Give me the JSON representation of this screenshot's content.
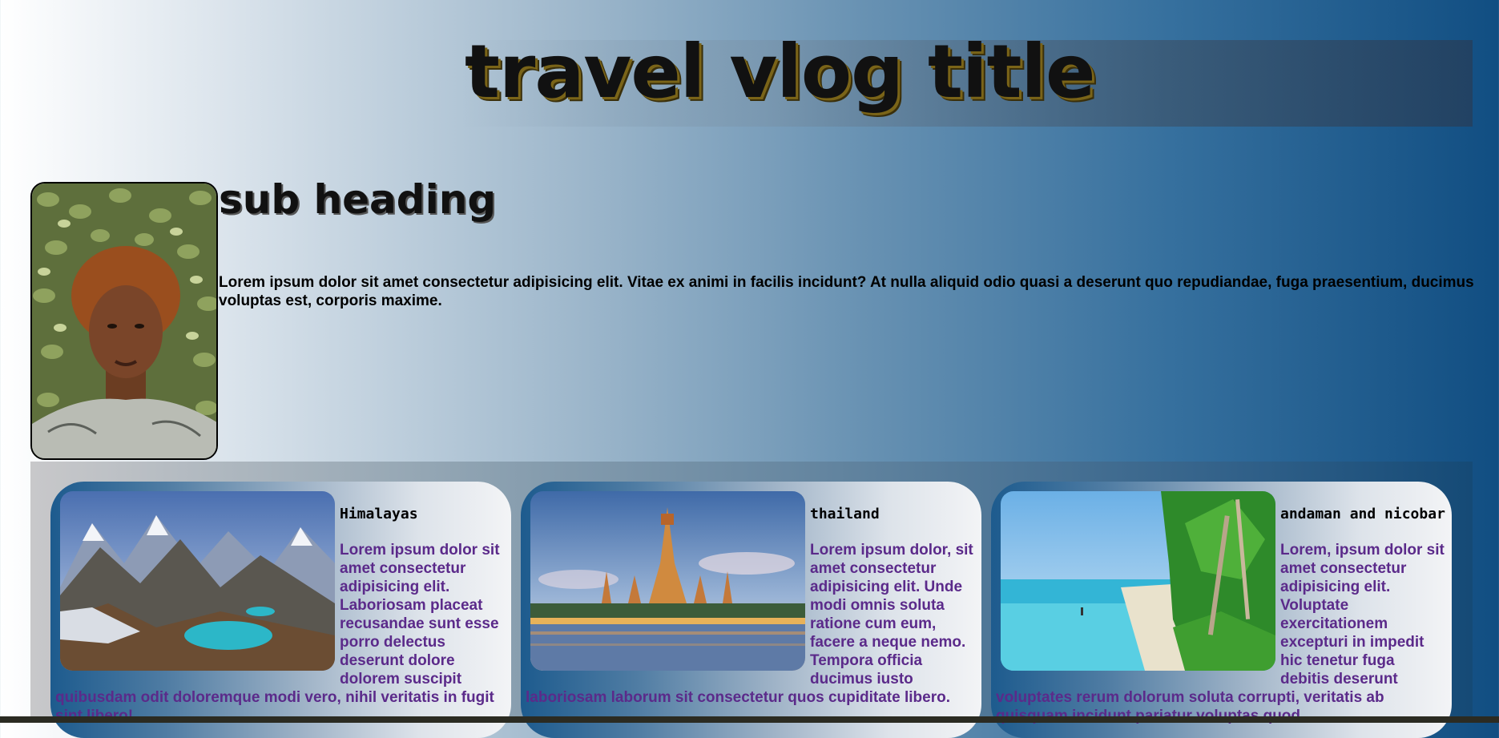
{
  "header": {
    "title": "travel vlog title"
  },
  "intro": {
    "subheading": "sub heading",
    "text": "Lorem ipsum dolor sit amet consectetur adipisicing elit. Vitae ex animi in facilis incidunt? At nulla aliquid odio quasi a deserunt quo repudiandae, fuga praesentium, ducimus voluptas est, corporis maxime."
  },
  "cards": [
    {
      "title": "Himalayas",
      "text_side": "Lorem ipsum dolor sit amet consectetur adipisicing elit. Laboriosam placeat recusandae sunt esse porro delectus deserunt dolore dolorem suscipit",
      "text_tail": "quibusdam odit doloremque modi vero, nihil veritatis in fugit sint libero!"
    },
    {
      "title": "thailand",
      "text_side": "Lorem ipsum dolor, sit amet consectetur adipisicing elit. Unde modi omnis soluta ratione cum eum, facere a neque nemo. Tempora officia ducimus iusto",
      "text_tail": "laboriosam laborum sit consectetur quos cupiditate libero."
    },
    {
      "title": "andaman and nicobar",
      "text_side": "Lorem, ipsum dolor sit amet consectetur adipisicing elit. Voluptate exercitationem excepturi in impedit hic tenetur fuga debitis deserunt",
      "text_tail": "voluptates rerum dolorum soluta corrupti, veritatis ab quisquam incidunt pariatur voluptas quod."
    }
  ]
}
